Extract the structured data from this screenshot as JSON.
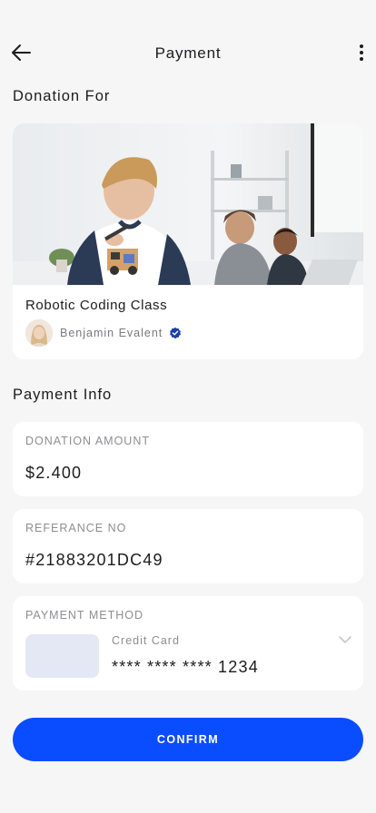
{
  "header": {
    "title": "Payment",
    "back_icon": "arrow-left-icon",
    "more_icon": "more-vertical-icon"
  },
  "donation": {
    "section_title": "Donation For",
    "course_title": "Robotic Coding Class",
    "author_name": "Benjamin Evalent",
    "verified_icon": "verified-badge-icon"
  },
  "payment_info": {
    "section_title": "Payment Info",
    "amount_label": "DONATION AMOUNT",
    "amount_value": "$2.400",
    "reference_label": "REFERANCE NO",
    "reference_value": "#21883201DC49",
    "method_label": "PAYMENT METHOD",
    "method_type": "Credit Card",
    "card_number": "**** **** **** 1234",
    "chevron_icon": "chevron-down-icon"
  },
  "confirm_label": "CONFIRM",
  "colors": {
    "accent": "#0a4dff",
    "verified": "#1a3fb0",
    "background": "#f6f6f7"
  }
}
